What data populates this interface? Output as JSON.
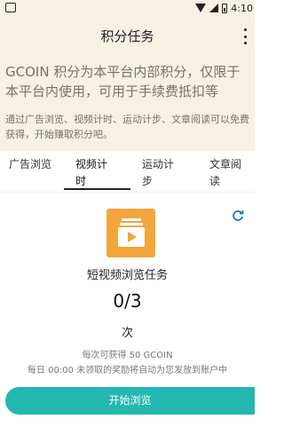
{
  "status_bar": {
    "time": "4:10"
  },
  "app_bar": {
    "title": "积分任务"
  },
  "hero": {
    "headline": "GCOIN 积分为本平台内部积分，仅限于本平台内使用，可用于手续费抵扣等",
    "description": "通过广告浏览、视频计时、运动计步、文章阅读可以免费获得，开始赚取积分吧。"
  },
  "tabs": [
    {
      "label": "广告浏览",
      "active": false
    },
    {
      "label": "视频计时",
      "active": true
    },
    {
      "label": "运动计步",
      "active": false
    },
    {
      "label": "文章阅读",
      "active": false
    }
  ],
  "task": {
    "name": "短视频浏览任务",
    "progress_text": "0/3",
    "unit": "次",
    "reward_text": "每次可获得 50 GCOIN",
    "note": "每日 00:00 未领取的奖励将自动为您发放到账户中",
    "icon": "video-icon",
    "icon_color": "#f2a63b"
  },
  "start_button": {
    "label": "开始浏览",
    "color": "#22b8b0"
  },
  "colors": {
    "accent": "#1a73c9",
    "hero_bg": "#f7f1e4"
  }
}
